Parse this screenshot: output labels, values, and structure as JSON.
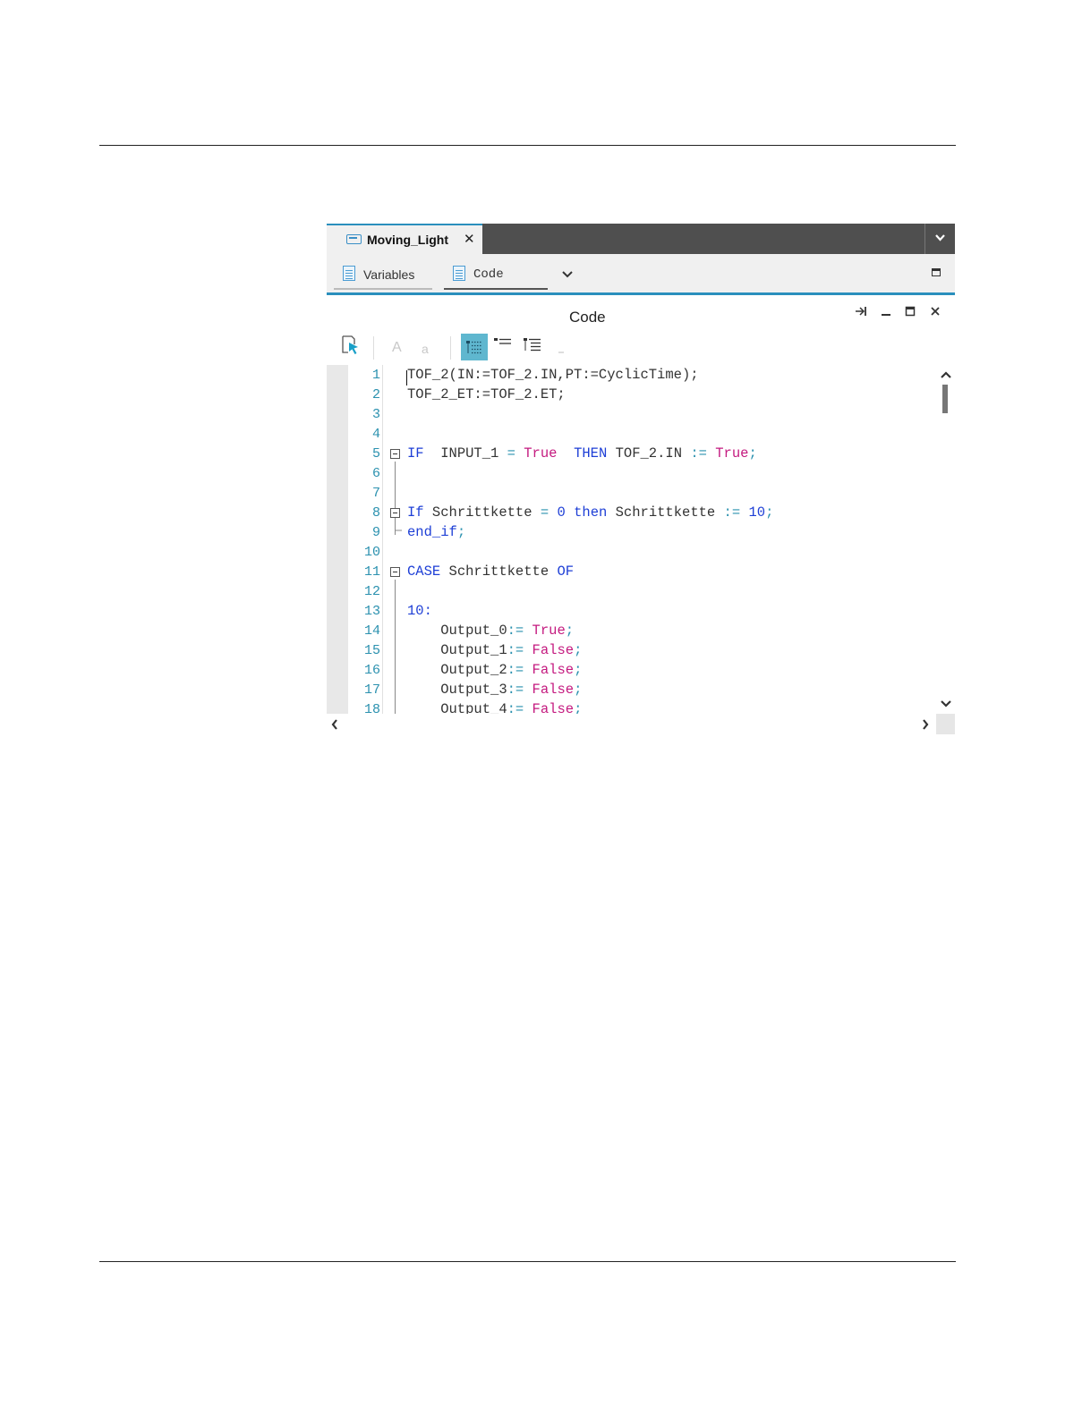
{
  "document_tab": {
    "title": "Moving_Light",
    "close": "✕"
  },
  "subtabs": {
    "variables": "Variables",
    "code": "Code"
  },
  "panel": {
    "title": "Code"
  },
  "toolbar": {
    "font_large": "A",
    "font_small": "a"
  },
  "editor": {
    "line_numbers": [
      "1",
      "2",
      "3",
      "4",
      "5",
      "6",
      "7",
      "8",
      "9",
      "10",
      "11",
      "12",
      "13",
      "14",
      "15",
      "16",
      "17",
      "18"
    ]
  },
  "colors": {
    "accent": "#2a8fbd",
    "keyword": "#1e3fd6",
    "literal": "#c41a7f",
    "line_number": "#2b91af"
  }
}
